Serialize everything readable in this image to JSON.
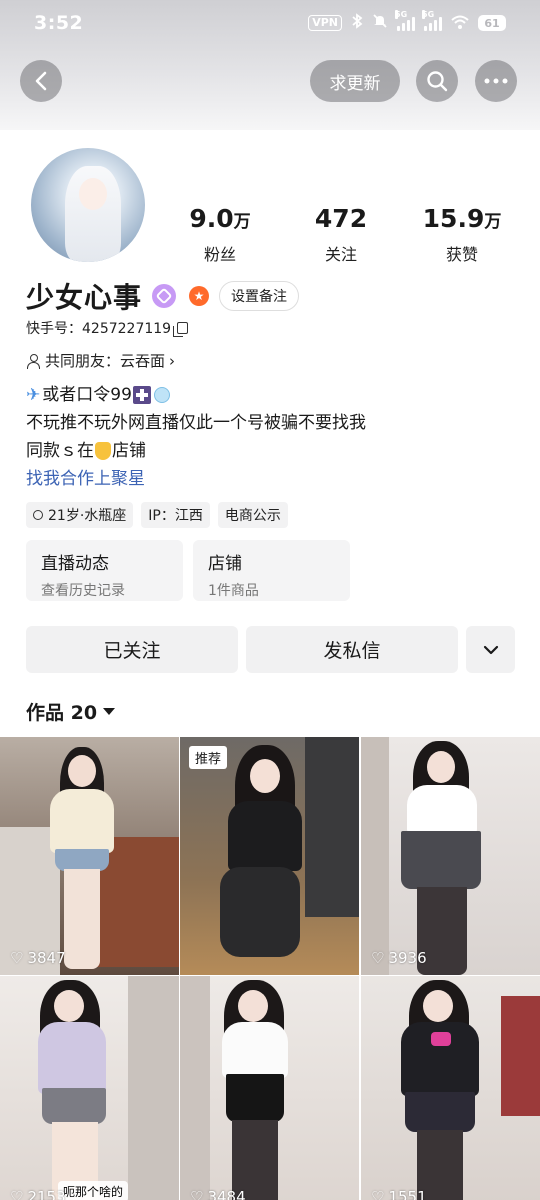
{
  "status_bar": {
    "time": "3:52",
    "vpn": "VPN",
    "sig1": "5G",
    "sig2": "5G",
    "battery": "61"
  },
  "header": {
    "refresh_label": "求更新"
  },
  "profile": {
    "stats": [
      {
        "num": "9.0",
        "unit": "万",
        "label": "粉丝"
      },
      {
        "num": "472",
        "unit": "",
        "label": "关注"
      },
      {
        "num": "15.9",
        "unit": "万",
        "label": "获赞"
      }
    ],
    "name": "少女心事",
    "remark_button": "设置备注",
    "kid": "快手号：4257227119",
    "friends": "共同朋友：云吞面",
    "bio": {
      "line1": "或者口令99",
      "line2": "不玩推不玩外网直播仅此一个号被骗不要找我",
      "line3a": "同款ｓ在",
      "line3b": "店铺",
      "line4": "找我合作上聚星"
    },
    "tags": [
      "21岁·水瓶座",
      "IP：江西",
      "电商公示"
    ]
  },
  "cards": [
    {
      "title": "直播动态",
      "sub": "查看历史记录"
    },
    {
      "title": "店铺",
      "sub": "1件商品"
    }
  ],
  "actions": {
    "followed": "已关注",
    "message": "发私信"
  },
  "works_tab": {
    "label": "作品 20"
  },
  "grid": [
    {
      "likes": "3847"
    },
    {
      "likes": "",
      "badge": "推荐"
    },
    {
      "likes": "3936"
    },
    {
      "likes": "2153",
      "caption": "呃那个啥的"
    },
    {
      "likes": "3484"
    },
    {
      "likes": "1551"
    }
  ]
}
